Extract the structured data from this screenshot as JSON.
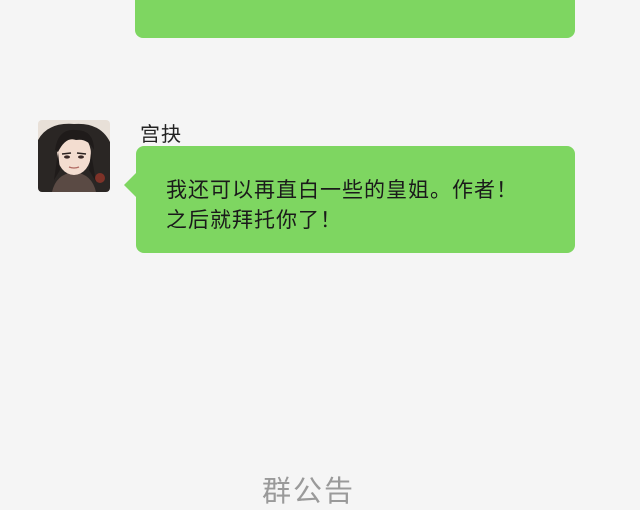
{
  "chat": {
    "colors": {
      "background": "#f5f5f5",
      "bubble": "#7ed661",
      "text": "#1a1a1a",
      "name": "#222222",
      "announcement": "#9a9a9a"
    },
    "message": {
      "sender": "宫抉",
      "avatar_icon": "anime-character-avatar-icon",
      "lines": [
        "我还可以再直白一些的皇姐。作者！",
        "之后就拜托你了！"
      ]
    },
    "announcement_label": "群公告"
  }
}
